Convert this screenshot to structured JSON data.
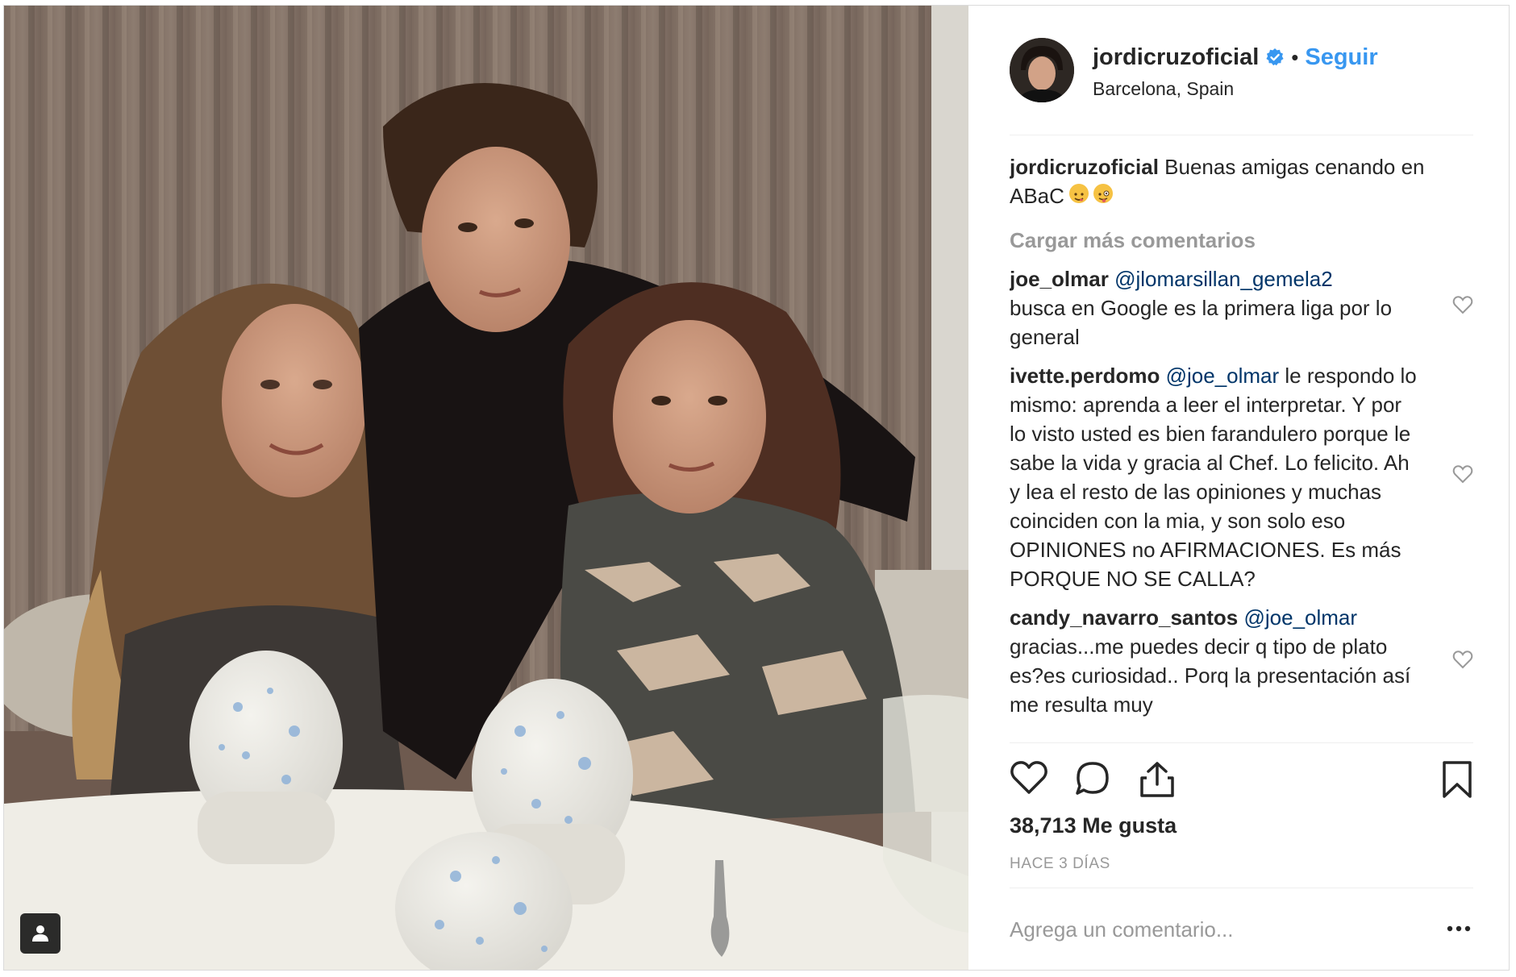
{
  "photo": {
    "alt_icon": "user-tag-icon"
  },
  "header": {
    "username": "jordicruzoficial",
    "separator": "•",
    "follow_label": "Seguir",
    "location": "Barcelona, Spain"
  },
  "caption": {
    "username": "jordicruzoficial",
    "text": "Buenas amigas cenando en ABaC"
  },
  "load_more": "Cargar más comentarios",
  "comments": [
    {
      "username": "joe_olmar",
      "mention": "@jlomarsillan_gemela2",
      "text": "busca en Google es la primera liga por lo general"
    },
    {
      "username": "ivette.perdomo",
      "mention": "@joe_olmar",
      "text": "le respondo lo mismo: aprenda a leer el interpretar. Y por lo visto usted es bien farandulero porque le sabe la vida y gracia al Chef. Lo felicito. Ah y lea el resto de las opiniones y muchas coinciden con la mia, y son solo eso OPINIONES no AFIRMACIONES. Es más PORQUE NO SE CALLA?"
    },
    {
      "username": "candy_navarro_santos",
      "mention": "@joe_olmar",
      "text": "gracias...me puedes decir q tipo de plato es?es curiosidad.. Porq la presentación así me resulta muy"
    }
  ],
  "likes": "38,713 Me gusta",
  "time": "HACE 3 DÍAS",
  "add_comment": {
    "placeholder": "Agrega un comentario..."
  },
  "colors": {
    "link": "#3897f0",
    "mention": "#003569",
    "muted": "#999999",
    "text": "#262626"
  }
}
